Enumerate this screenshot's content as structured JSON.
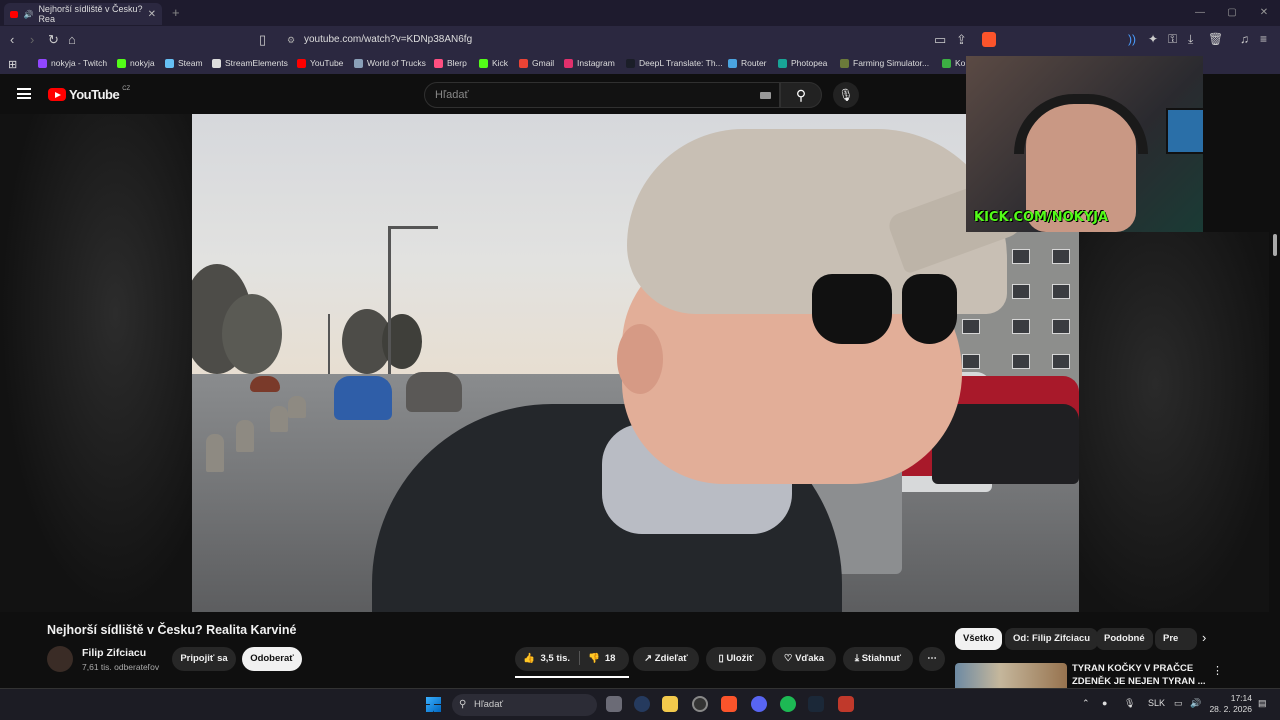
{
  "browser": {
    "tab_title": "Nejhorší sídliště v Česku? Rea",
    "tab_close": "✕",
    "new_tab": "+",
    "url": "youtube.com/watch?v=KDNp38AN6fg",
    "bookmarks": [
      {
        "label": "nokyja - Twitch",
        "color": "#9146ff"
      },
      {
        "label": "nokyja",
        "color": "#53fc18"
      },
      {
        "label": "Steam",
        "color": "#66c0f4"
      },
      {
        "label": "StreamElements",
        "color": "#dddddd"
      },
      {
        "label": "YouTube",
        "color": "#ff0000"
      },
      {
        "label": "World of Trucks",
        "color": "#8aa0b8"
      },
      {
        "label": "Blerp",
        "color": "#ff4f81"
      },
      {
        "label": "Kick",
        "color": "#53fc18"
      },
      {
        "label": "Gmail",
        "color": "#ea4335"
      },
      {
        "label": "Instagram",
        "color": "#e1306c"
      },
      {
        "label": "DeepL Translate: Th...",
        "color": "#1b1e28"
      },
      {
        "label": "Router",
        "color": "#4aa3df"
      },
      {
        "label": "Photopea",
        "color": "#18a497"
      },
      {
        "label": "Farming Simulator...",
        "color": "#6b7a3a"
      },
      {
        "label": "Ko",
        "color": "#3cb043"
      }
    ]
  },
  "youtube": {
    "logo_text": "YouTube",
    "country": "CZ",
    "search_placeholder": "Hľadať"
  },
  "overlay": {
    "kick_text": "KICK.COM/NOKYJA"
  },
  "video": {
    "title": "Nejhorší sídliště v Česku? Realita Karviné",
    "channel": "Filip Zifciacu",
    "subscribers": "7,61 tis. odberateľov",
    "join": "Pripojiť sa",
    "subscribe": "Odoberať",
    "likes": "3,5 tis.",
    "dislikes": "18",
    "share": "Zdieľať",
    "save": "Uložiť",
    "thanks": "Vďaka",
    "download": "Stiahnuť",
    "more": "⋯"
  },
  "sidebar": {
    "chips": [
      "Všetko",
      "Od: Filip Zifciacu",
      "Podobné",
      "Pre va"
    ],
    "reco_title": "TYRAN KOČKY V PRAČCE ZDENĚK JE NEJEN TYRAN ..."
  },
  "taskbar": {
    "search": "Hľadať",
    "lang": "SLK",
    "time": "17:14",
    "date": "28. 2. 2026"
  }
}
